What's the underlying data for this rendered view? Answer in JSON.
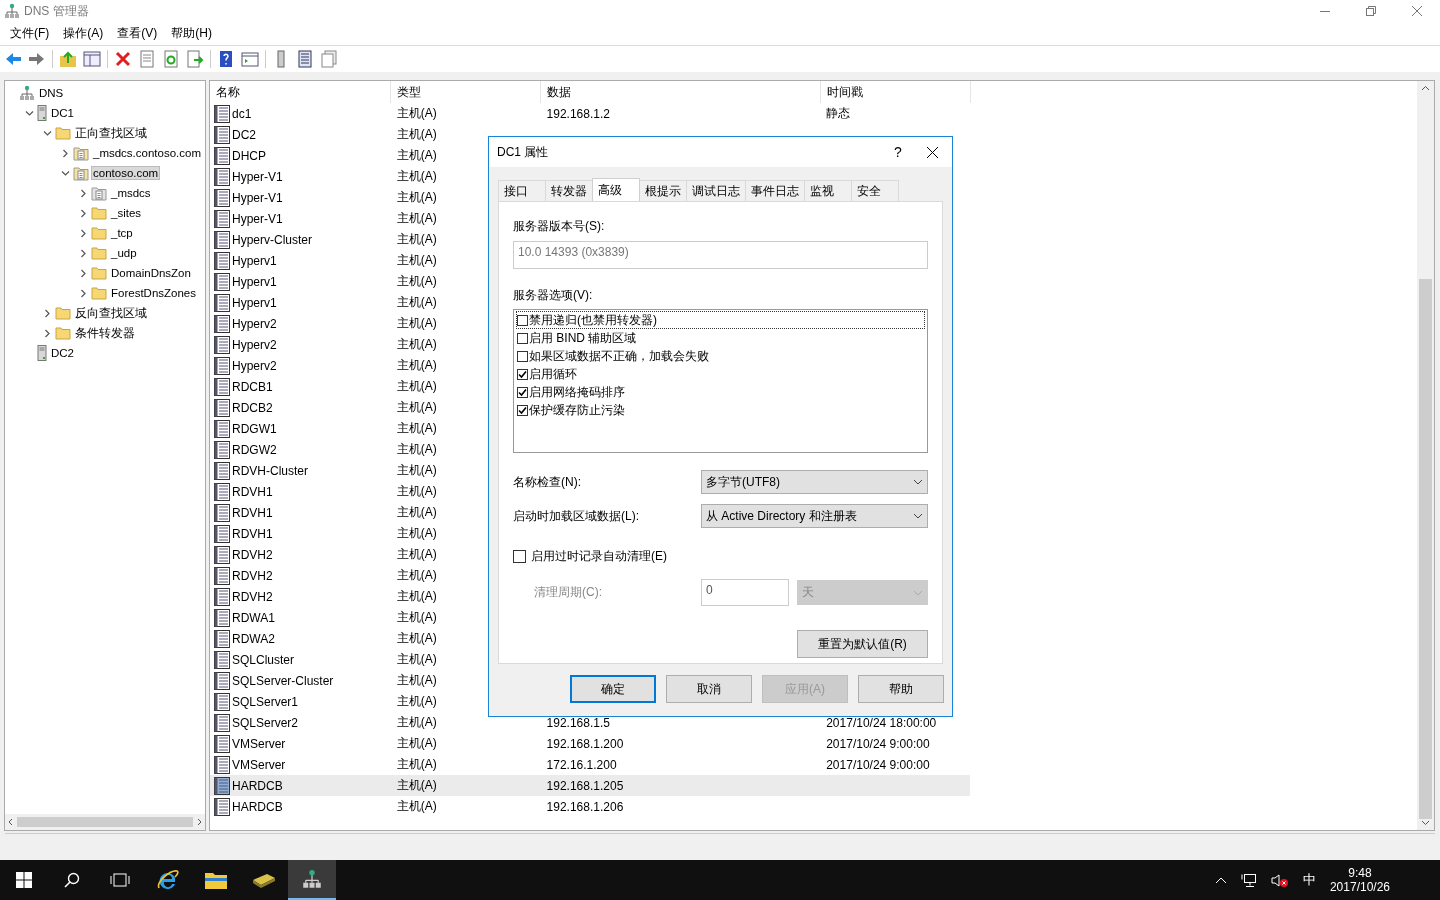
{
  "window": {
    "title": "DNS 管理器"
  },
  "menu": [
    "文件(F)",
    "操作(A)",
    "查看(V)",
    "帮助(H)"
  ],
  "tree": [
    {
      "label": "DNS",
      "kind": "dns",
      "selected": false,
      "children": [
        {
          "label": "DC1",
          "kind": "server",
          "expanded": true,
          "selected": false,
          "children": [
            {
              "label": "正向查找区域",
              "kind": "folder",
              "expanded": true,
              "selected": false,
              "children": [
                {
                  "label": "_msdcs.contoso.com",
                  "kind": "zone",
                  "expanded": false,
                  "selected": false
                },
                {
                  "label": "contoso.com",
                  "kind": "zone",
                  "expanded": true,
                  "selected": true,
                  "children": [
                    {
                      "label": "_msdcs",
                      "kind": "zone",
                      "expanded": false,
                      "selected": false
                    },
                    {
                      "label": "_sites",
                      "kind": "folder",
                      "expanded": false,
                      "selected": false
                    },
                    {
                      "label": "_tcp",
                      "kind": "folder",
                      "expanded": false,
                      "selected": false
                    },
                    {
                      "label": "_udp",
                      "kind": "folder",
                      "expanded": false,
                      "selected": false
                    },
                    {
                      "label": "DomainDnsZon",
                      "kind": "folder",
                      "expanded": false,
                      "selected": false
                    },
                    {
                      "label": "ForestDnsZones",
                      "kind": "folder",
                      "expanded": false,
                      "selected": false
                    }
                  ]
                }
              ]
            },
            {
              "label": "反向查找区域",
              "kind": "folder",
              "expanded": false,
              "selected": false
            },
            {
              "label": "条件转发器",
              "kind": "folder",
              "expanded": false,
              "selected": false
            }
          ]
        },
        {
          "label": "DC2",
          "kind": "server",
          "selected": false
        }
      ]
    }
  ],
  "table": {
    "columns": [
      "名称",
      "类型",
      "数据",
      "时间戳"
    ],
    "rows": [
      {
        "name": "dc1",
        "type": "主机(A)",
        "data": "192.168.1.2",
        "timestamp": "静态",
        "selected": false
      },
      {
        "name": "DC2",
        "type": "主机(A)",
        "selected": false
      },
      {
        "name": "DHCP",
        "type": "主机(A)",
        "selected": false
      },
      {
        "name": "Hyper-V1",
        "type": "主机(A)",
        "selected": false
      },
      {
        "name": "Hyper-V1",
        "type": "主机(A)",
        "selected": false
      },
      {
        "name": "Hyper-V1",
        "type": "主机(A)",
        "selected": false
      },
      {
        "name": "Hyperv-Cluster",
        "type": "主机(A)",
        "selected": false
      },
      {
        "name": "Hyperv1",
        "type": "主机(A)",
        "selected": false
      },
      {
        "name": "Hyperv1",
        "type": "主机(A)",
        "selected": false
      },
      {
        "name": "Hyperv1",
        "type": "主机(A)",
        "selected": false
      },
      {
        "name": "Hyperv2",
        "type": "主机(A)",
        "selected": false
      },
      {
        "name": "Hyperv2",
        "type": "主机(A)",
        "selected": false
      },
      {
        "name": "Hyperv2",
        "type": "主机(A)",
        "selected": false
      },
      {
        "name": "RDCB1",
        "type": "主机(A)",
        "selected": false
      },
      {
        "name": "RDCB2",
        "type": "主机(A)",
        "selected": false
      },
      {
        "name": "RDGW1",
        "type": "主机(A)",
        "selected": false
      },
      {
        "name": "RDGW2",
        "type": "主机(A)",
        "selected": false
      },
      {
        "name": "RDVH-Cluster",
        "type": "主机(A)",
        "selected": false
      },
      {
        "name": "RDVH1",
        "type": "主机(A)",
        "selected": false
      },
      {
        "name": "RDVH1",
        "type": "主机(A)",
        "selected": false
      },
      {
        "name": "RDVH1",
        "type": "主机(A)",
        "selected": false
      },
      {
        "name": "RDVH2",
        "type": "主机(A)",
        "selected": false
      },
      {
        "name": "RDVH2",
        "type": "主机(A)",
        "selected": false
      },
      {
        "name": "RDVH2",
        "type": "主机(A)",
        "selected": false
      },
      {
        "name": "RDWA1",
        "type": "主机(A)",
        "selected": false
      },
      {
        "name": "RDWA2",
        "type": "主机(A)",
        "selected": false
      },
      {
        "name": "SQLCluster",
        "type": "主机(A)",
        "selected": false
      },
      {
        "name": "SQLServer-Cluster",
        "type": "主机(A)",
        "selected": false
      },
      {
        "name": "SQLServer1",
        "type": "主机(A)",
        "selected": false
      },
      {
        "name": "SQLServer2",
        "type": "主机(A)",
        "data": "192.168.1.5",
        "timestamp": "2017/10/24 18:00:00",
        "selected": false
      },
      {
        "name": "VMServer",
        "type": "主机(A)",
        "data": "192.168.1.200",
        "timestamp": "2017/10/24 9:00:00",
        "selected": false
      },
      {
        "name": "VMServer",
        "type": "主机(A)",
        "data": "172.16.1.200",
        "timestamp": "2017/10/24 9:00:00",
        "selected": false
      },
      {
        "name": "HARDCB",
        "type": "主机(A)",
        "data": "192.168.1.205",
        "selected": true
      },
      {
        "name": "HARDCB",
        "type": "主机(A)",
        "data": "192.168.1.206",
        "selected": false
      }
    ]
  },
  "dialog": {
    "title": "DC1 属性",
    "help": "?",
    "tabs": [
      {
        "label": "接口",
        "selected": false
      },
      {
        "label": "转发器",
        "selected": false
      },
      {
        "label": "高级",
        "selected": true
      },
      {
        "label": "根提示",
        "selected": false
      },
      {
        "label": "调试日志",
        "selected": false
      },
      {
        "label": "事件日志",
        "selected": false
      },
      {
        "label": "监视",
        "selected": false
      },
      {
        "label": "安全",
        "selected": false
      }
    ],
    "version_label": "服务器版本号(S):",
    "version": "10.0 14393 (0x3839)",
    "options_label": "服务器选项(V):",
    "options": [
      {
        "label": "禁用递归(也禁用转发器)",
        "checked": false,
        "focused": true
      },
      {
        "label": "启用 BIND 辅助区域",
        "checked": false,
        "focused": false
      },
      {
        "label": "如果区域数据不正确，加载会失败",
        "checked": false,
        "focused": false
      },
      {
        "label": "启用循环",
        "checked": true,
        "focused": false
      },
      {
        "label": "启用网络掩码排序",
        "checked": true,
        "focused": false
      },
      {
        "label": "保护缓存防止污染",
        "checked": true,
        "focused": false
      }
    ],
    "name_check": {
      "label": "名称检查(N):",
      "value": "多字节(UTF8)"
    },
    "load_zone": {
      "label": "启动时加载区域数据(L):",
      "value": "从 Active Directory 和注册表"
    },
    "scavenging": {
      "label": "启用过时记录自动清理(E)",
      "checked": false
    },
    "period": {
      "label": "清理周期(C):",
      "value": "0",
      "unit": "天",
      "disabled": true
    },
    "reset_button": "重置为默认值(R)",
    "buttons": [
      {
        "label": "确定",
        "default": true,
        "disabled": false
      },
      {
        "label": "取消",
        "default": false,
        "disabled": false
      },
      {
        "label": "应用(A)",
        "default": false,
        "disabled": true
      },
      {
        "label": "帮助",
        "default": false,
        "disabled": false
      }
    ]
  },
  "taskbar": {
    "ime": "中",
    "time": "9:48",
    "date": "2017/10/26"
  }
}
